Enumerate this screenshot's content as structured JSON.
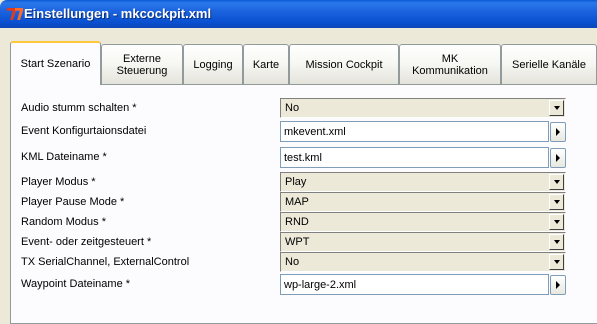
{
  "window": {
    "title": "Einstellungen - mkcockpit.xml"
  },
  "tabs": [
    {
      "label": "Start Szenario",
      "active": true
    },
    {
      "label": "Externe\nSteuerung",
      "active": false
    },
    {
      "label": "Logging",
      "active": false
    },
    {
      "label": "Karte",
      "active": false
    },
    {
      "label": "Mission Cockpit",
      "active": false
    },
    {
      "label": "MK\nKommunikation",
      "active": false
    },
    {
      "label": "Serielle Kanäle",
      "active": false
    }
  ],
  "settings": [
    {
      "label": "Audio stumm schalten *",
      "type": "dropdown",
      "value": "No"
    },
    {
      "label": "Event Konfigurtaionsdatei",
      "type": "file",
      "value": "mkevent.xml"
    },
    {
      "label": "KML Dateiname *",
      "type": "file",
      "value": "test.kml"
    },
    {
      "label": "Player Modus *",
      "type": "dropdown",
      "value": "Play"
    },
    {
      "label": "Player Pause Mode *",
      "type": "dropdown",
      "value": "MAP"
    },
    {
      "label": "Random Modus *",
      "type": "dropdown",
      "value": "RND"
    },
    {
      "label": "Event- oder zeitgesteuert *",
      "type": "dropdown",
      "value": "WPT"
    },
    {
      "label": "TX SerialChannel, ExternalControl",
      "type": "dropdown",
      "value": "No"
    },
    {
      "label": "Waypoint Dateiname *",
      "type": "file",
      "value": "wp-large-2.xml"
    }
  ],
  "colors": {
    "titlebar": "#0a5ad6",
    "dialog_bg": "#ece9d8",
    "panel_bg": "#fcfcfe",
    "active_tab_accent": "#ffc73c",
    "input_border": "#7f9db9"
  }
}
